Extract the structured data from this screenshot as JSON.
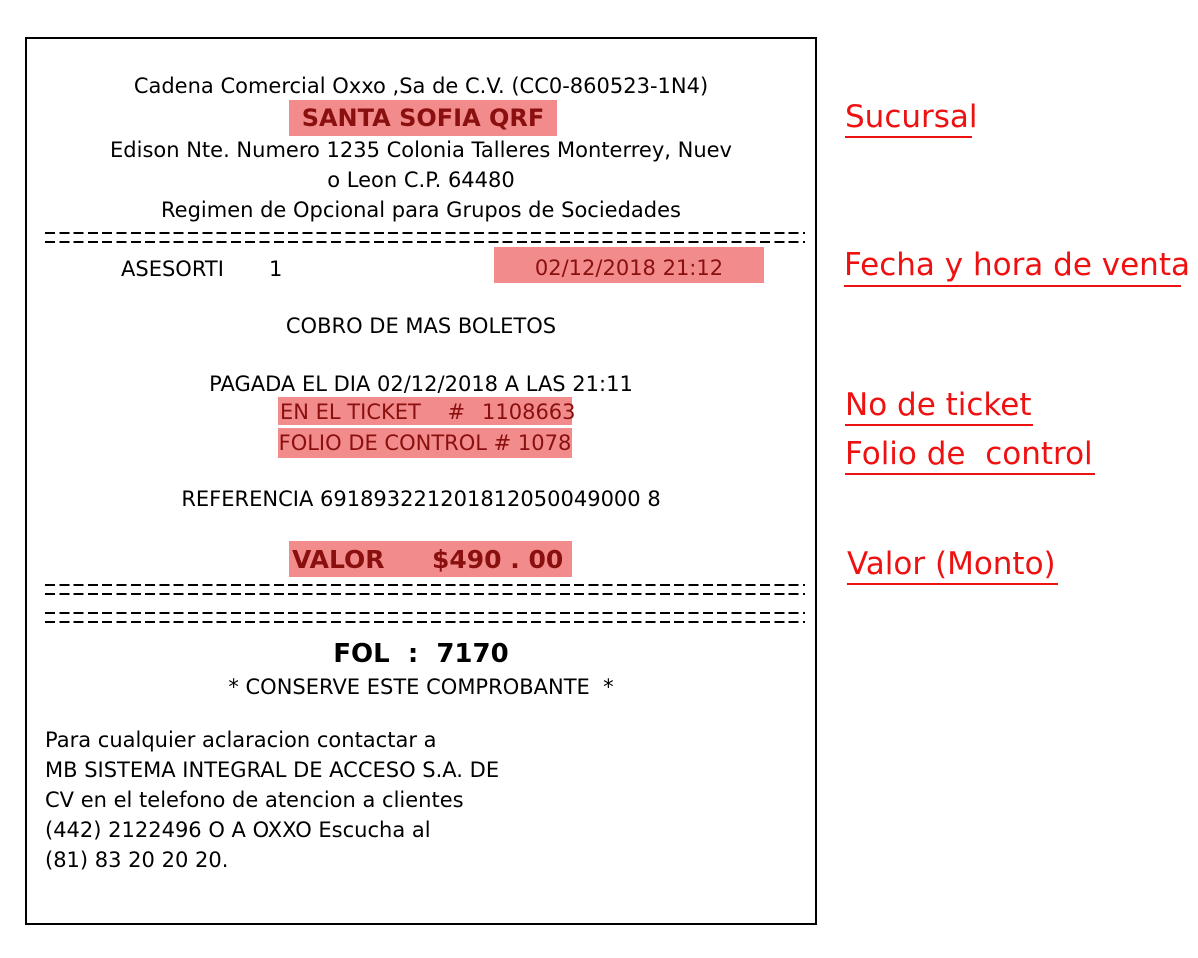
{
  "receipt": {
    "company": "Cadena Comercial Oxxo ,Sa de C.V. (CC0-860523-1N4)",
    "branch": "SANTA SOFIA QRF",
    "address_line1": "Edison Nte. Numero 1235 Colonia Talleres Monterrey, Nuev",
    "address_line2": "o Leon C.P. 64480",
    "regime": "Regimen de Opcional para Grupos de Sociedades",
    "separator": "================================================",
    "cashier_label": "ASESORTI",
    "cashier_number": "1",
    "sale_datetime": "02/12/2018 21:12",
    "service": "COBRO DE MAS BOLETOS",
    "paid_on": "PAGADA EL DIA 02/12/2018 A LAS 21:11",
    "ticket_label": "EN EL TICKET    #",
    "ticket_number": "1108663",
    "control_folio": "FOLIO DE CONTROL # 1078",
    "reference": "REFERENCIA 691893221201812050049000 8",
    "value_label": "VALOR",
    "value_amount": "$490 . 00",
    "fol": "FOL  :  7170",
    "keep_receipt": "* CONSERVE ESTE COMPROBANTE  *",
    "contact_lines": [
      "Para cualquier aclaracion contactar a",
      "MB SISTEMA INTEGRAL DE ACCESO S.A. DE",
      "CV en el telefono de atencion a clientes",
      "(442) 2122496 O A OXXO Escucha al",
      "(81) 83 20 20 20."
    ]
  },
  "callouts": {
    "branch": "Sucursal",
    "datetime": "Fecha y hora de venta",
    "ticket": "No de ticket",
    "folio": "Folio de  control",
    "value": "Valor (Monto)"
  },
  "colors": {
    "highlight": "#f28b8b",
    "highlight_text": "#8a0f0f",
    "callout": "#ee1111"
  }
}
